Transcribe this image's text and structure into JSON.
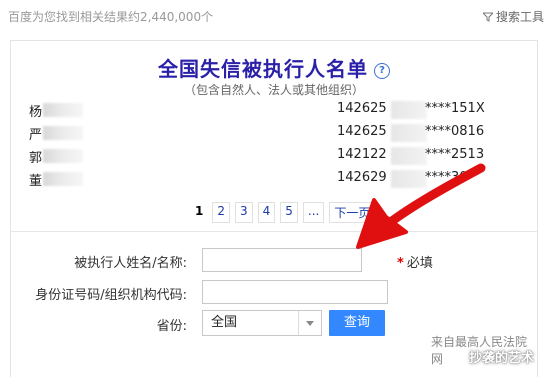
{
  "topbar": {
    "result_count": "百度为您找到相关结果约2,440,000个",
    "search_tools": "搜索工具",
    "filter_icon": "filter-icon"
  },
  "card": {
    "title": "全国失信被执行人名单",
    "help_icon": "help-icon",
    "help_symbol": "?",
    "subtitle": "（包含自然人、法人或其他组织）",
    "rows": [
      {
        "name": "杨",
        "id_prefix": "142625",
        "id_suffix": "****151X"
      },
      {
        "name": "严",
        "id_prefix": "142625",
        "id_suffix": "****0816"
      },
      {
        "name": "郭",
        "id_prefix": "142122",
        "id_suffix": "****2513"
      },
      {
        "name": "董",
        "id_prefix": "142629",
        "id_suffix": "****30"
      }
    ],
    "pagination": {
      "current": "1",
      "pages": [
        "2",
        "3",
        "4",
        "5",
        "..."
      ],
      "next": "下一页"
    },
    "form": {
      "name_label": "被执行人姓名/名称:",
      "name_value": "",
      "required_star": "*",
      "required_text": "必填",
      "id_label": "身份证号码/组织机构代码:",
      "id_value": "",
      "province_label": "省份:",
      "province_value": "全国",
      "query_button": "查询"
    },
    "source_text": "来自最高人民法院网",
    "watermark": "抄袭的艺术"
  },
  "annotation": {
    "arrow_color": "#e01010"
  }
}
